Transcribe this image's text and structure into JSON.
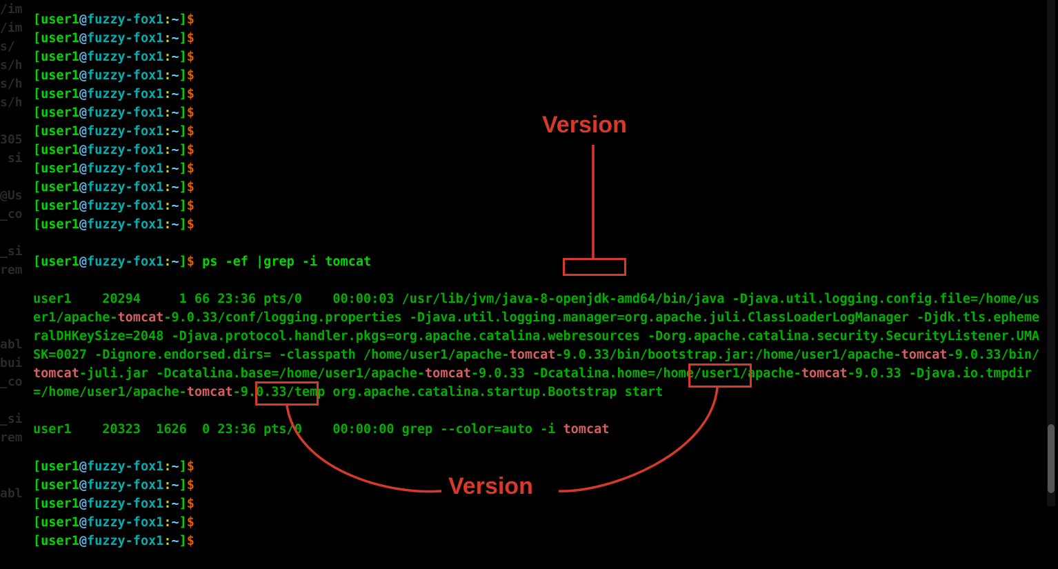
{
  "left_strip": "/im\n/im\ns/\ns/h\ns/h\ns/h\n\n305\n si\n\n@Us\n_co\n\n_si\nrem\n\n\n\nabl\nbui\n_co\n\n_si\nrem\n\n\nabl",
  "prompt": {
    "bracket_open": "[",
    "user": "user1",
    "at": "@",
    "host": "fuzzy-fox1",
    "colon": ":",
    "path": "~",
    "bracket_close": "]",
    "dollar": "$"
  },
  "command": "ps -ef |grep -i tomcat",
  "ps_output": {
    "line1_pre": "user1    20294     1 66 23:36 pts/0    00:00:03 /usr/lib/jvm/java-8-openjdk-amd64/bin/java -Djava.util.logging.config.file=/home/user1/apache-",
    "tc1": "tomcat",
    "seg1": "-9.0.33/conf/logging.properties -Djava.util.logging.manager=org.apache.juli.ClassLoaderLogManager -Djdk.tls.ephemeralDHKeySize=2048 -Djava.protocol.handler.pkgs=org.apache.catalina.webresources -Dorg.apache.catalina.security.SecurityListener.UMASK=0027 -Dignore.endorsed.dirs= -classpath /home/user1/apache-",
    "tc2": "tomcat",
    "seg2": "-9.0.33/bin/bootstrap.jar:/home/user1/apache-",
    "tc3": "tomcat",
    "seg3": "-9.0.33/bin/",
    "tc4": "tomcat",
    "seg4": "-juli.jar -Dcatalina.base=/home/user1/apache-",
    "tc5": "tomcat",
    "seg5": "-9.0.33 -Dcatalina.home=/home/user1/apache-",
    "tc6": "tomcat",
    "seg6": "-9.0.33 -Djava.io.tmpdir=/home/user1/apache-",
    "tc7": "tomcat",
    "seg7": "-9.0.33/temp org.apache.catalina.startup.Bootstrap start",
    "line2_pre": "user1    20323  1626  0 23:36 pts/0    00:00:00 grep --color=auto -i ",
    "tc8": "tomcat"
  },
  "annotations": {
    "label_top": "Version",
    "label_bottom": "Version",
    "highlighted_version": "9.0.33"
  },
  "colors": {
    "annotation": "#d73a2a",
    "terminal_green": "#00d700",
    "grep_highlight": "#d75f5f"
  },
  "empty_prompts_before": 12,
  "empty_prompts_after": 5
}
